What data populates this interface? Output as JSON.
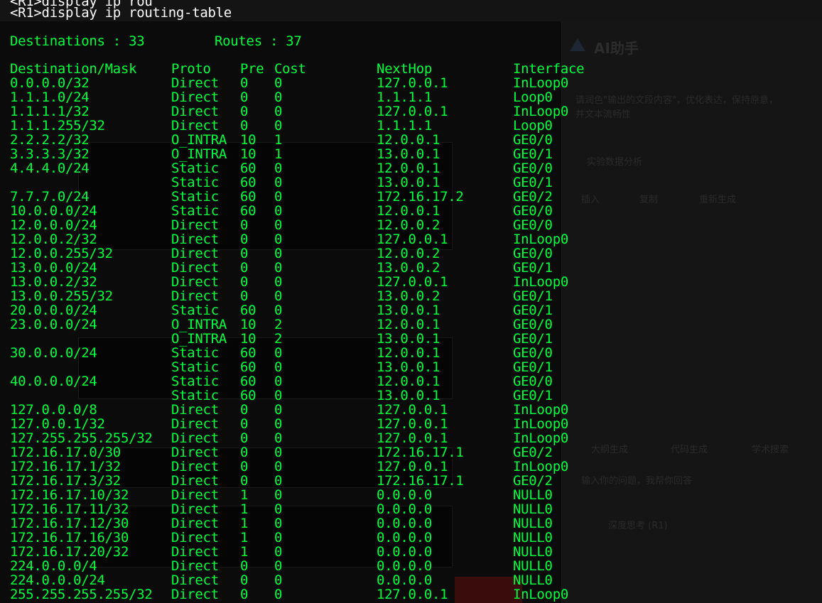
{
  "terminal": {
    "prompt_prev": "<R1>display ip rou",
    "command": "<R1>display ip routing-table",
    "summary": {
      "destinations_label": "Destinations : 33",
      "routes_label": "Routes : 37"
    },
    "headers": {
      "destination": "Destination/Mask",
      "proto": "Proto",
      "pre": "Pre",
      "cost": "Cost",
      "nexthop": "NextHop",
      "interface": "Interface"
    },
    "routes": [
      {
        "dest": "0.0.0.0/32",
        "proto": "Direct",
        "pre": "0",
        "cost": "0",
        "nexthop": "127.0.0.1",
        "iface": "InLoop0"
      },
      {
        "dest": "1.1.1.0/24",
        "proto": "Direct",
        "pre": "0",
        "cost": "0",
        "nexthop": "1.1.1.1",
        "iface": "Loop0"
      },
      {
        "dest": "1.1.1.1/32",
        "proto": "Direct",
        "pre": "0",
        "cost": "0",
        "nexthop": "127.0.0.1",
        "iface": "InLoop0"
      },
      {
        "dest": "1.1.1.255/32",
        "proto": "Direct",
        "pre": "0",
        "cost": "0",
        "nexthop": "1.1.1.1",
        "iface": "Loop0"
      },
      {
        "dest": "2.2.2.2/32",
        "proto": "O_INTRA",
        "pre": "10",
        "cost": "1",
        "nexthop": "12.0.0.1",
        "iface": "GE0/0"
      },
      {
        "dest": "3.3.3.3/32",
        "proto": "O_INTRA",
        "pre": "10",
        "cost": "1",
        "nexthop": "13.0.0.1",
        "iface": "GE0/1"
      },
      {
        "dest": "4.4.4.0/24",
        "proto": "Static",
        "pre": "60",
        "cost": "0",
        "nexthop": "12.0.0.1",
        "iface": "GE0/0"
      },
      {
        "dest": "",
        "proto": "Static",
        "pre": "60",
        "cost": "0",
        "nexthop": "13.0.0.1",
        "iface": "GE0/1"
      },
      {
        "dest": "7.7.7.0/24",
        "proto": "Static",
        "pre": "60",
        "cost": "0",
        "nexthop": "172.16.17.2",
        "iface": "GE0/2"
      },
      {
        "dest": "10.0.0.0/24",
        "proto": "Static",
        "pre": "60",
        "cost": "0",
        "nexthop": "12.0.0.1",
        "iface": "GE0/0"
      },
      {
        "dest": "12.0.0.0/24",
        "proto": "Direct",
        "pre": "0",
        "cost": "0",
        "nexthop": "12.0.0.2",
        "iface": "GE0/0"
      },
      {
        "dest": "12.0.0.2/32",
        "proto": "Direct",
        "pre": "0",
        "cost": "0",
        "nexthop": "127.0.0.1",
        "iface": "InLoop0"
      },
      {
        "dest": "12.0.0.255/32",
        "proto": "Direct",
        "pre": "0",
        "cost": "0",
        "nexthop": "12.0.0.2",
        "iface": "GE0/0"
      },
      {
        "dest": "13.0.0.0/24",
        "proto": "Direct",
        "pre": "0",
        "cost": "0",
        "nexthop": "13.0.0.2",
        "iface": "GE0/1"
      },
      {
        "dest": "13.0.0.2/32",
        "proto": "Direct",
        "pre": "0",
        "cost": "0",
        "nexthop": "127.0.0.1",
        "iface": "InLoop0"
      },
      {
        "dest": "13.0.0.255/32",
        "proto": "Direct",
        "pre": "0",
        "cost": "0",
        "nexthop": "13.0.0.2",
        "iface": "GE0/1"
      },
      {
        "dest": "20.0.0.0/24",
        "proto": "Static",
        "pre": "60",
        "cost": "0",
        "nexthop": "13.0.0.1",
        "iface": "GE0/1"
      },
      {
        "dest": "23.0.0.0/24",
        "proto": "O_INTRA",
        "pre": "10",
        "cost": "2",
        "nexthop": "12.0.0.1",
        "iface": "GE0/0"
      },
      {
        "dest": "",
        "proto": "O_INTRA",
        "pre": "10",
        "cost": "2",
        "nexthop": "13.0.0.1",
        "iface": "GE0/1"
      },
      {
        "dest": "30.0.0.0/24",
        "proto": "Static",
        "pre": "60",
        "cost": "0",
        "nexthop": "12.0.0.1",
        "iface": "GE0/0"
      },
      {
        "dest": "",
        "proto": "Static",
        "pre": "60",
        "cost": "0",
        "nexthop": "13.0.0.1",
        "iface": "GE0/1"
      },
      {
        "dest": "40.0.0.0/24",
        "proto": "Static",
        "pre": "60",
        "cost": "0",
        "nexthop": "12.0.0.1",
        "iface": "GE0/0"
      },
      {
        "dest": "",
        "proto": "Static",
        "pre": "60",
        "cost": "0",
        "nexthop": "13.0.0.1",
        "iface": "GE0/1"
      },
      {
        "dest": "127.0.0.0/8",
        "proto": "Direct",
        "pre": "0",
        "cost": "0",
        "nexthop": "127.0.0.1",
        "iface": "InLoop0"
      },
      {
        "dest": "127.0.0.1/32",
        "proto": "Direct",
        "pre": "0",
        "cost": "0",
        "nexthop": "127.0.0.1",
        "iface": "InLoop0"
      },
      {
        "dest": "127.255.255.255/32",
        "proto": "Direct",
        "pre": "0",
        "cost": "0",
        "nexthop": "127.0.0.1",
        "iface": "InLoop0"
      },
      {
        "dest": "172.16.17.0/30",
        "proto": "Direct",
        "pre": "0",
        "cost": "0",
        "nexthop": "172.16.17.1",
        "iface": "GE0/2"
      },
      {
        "dest": "172.16.17.1/32",
        "proto": "Direct",
        "pre": "0",
        "cost": "0",
        "nexthop": "127.0.0.1",
        "iface": "InLoop0"
      },
      {
        "dest": "172.16.17.3/32",
        "proto": "Direct",
        "pre": "0",
        "cost": "0",
        "nexthop": "172.16.17.1",
        "iface": "GE0/2"
      },
      {
        "dest": "172.16.17.10/32",
        "proto": "Direct",
        "pre": "1",
        "cost": "0",
        "nexthop": "0.0.0.0",
        "iface": "NULL0"
      },
      {
        "dest": "172.16.17.11/32",
        "proto": "Direct",
        "pre": "1",
        "cost": "0",
        "nexthop": "0.0.0.0",
        "iface": "NULL0"
      },
      {
        "dest": "172.16.17.12/30",
        "proto": "Direct",
        "pre": "1",
        "cost": "0",
        "nexthop": "0.0.0.0",
        "iface": "NULL0"
      },
      {
        "dest": "172.16.17.16/30",
        "proto": "Direct",
        "pre": "1",
        "cost": "0",
        "nexthop": "0.0.0.0",
        "iface": "NULL0"
      },
      {
        "dest": "172.16.17.20/32",
        "proto": "Direct",
        "pre": "1",
        "cost": "0",
        "nexthop": "0.0.0.0",
        "iface": "NULL0"
      },
      {
        "dest": "224.0.0.0/4",
        "proto": "Direct",
        "pre": "0",
        "cost": "0",
        "nexthop": "0.0.0.0",
        "iface": "NULL0"
      },
      {
        "dest": "224.0.0.0/24",
        "proto": "Direct",
        "pre": "0",
        "cost": "0",
        "nexthop": "0.0.0.0",
        "iface": "NULL0"
      },
      {
        "dest": "255.255.255.255/32",
        "proto": "Direct",
        "pre": "0",
        "cost": "0",
        "nexthop": "127.0.0.1",
        "iface": "InLoop0"
      }
    ]
  },
  "background_app": {
    "assistant_title": "AI助手",
    "assistant_prompt": "请润色\"输出的文段内容\"，优化表达，保持原意，",
    "assistant_prompt2": "并文本流畅性",
    "data_analysis": "实验数据分析",
    "insert_label": "插入",
    "copy_label": "复制",
    "regenerate_label": "重新生成",
    "outline_label": "大纲生成",
    "code_label": "代码生成",
    "academic_label": "学术搜索",
    "input_placeholder": "输入你的问题，我帮你回答",
    "deep_think": "深度思考 (R1)"
  },
  "colors": {
    "terminal_text": "#00ff3c",
    "command_text": "#ffffff",
    "background": "#000000"
  }
}
